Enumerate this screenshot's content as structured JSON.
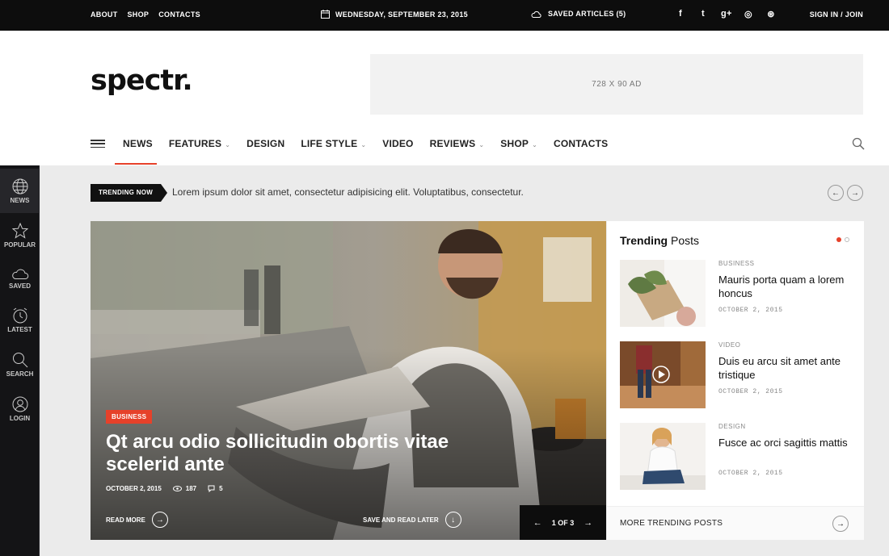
{
  "topbar": {
    "links": [
      "ABOUT",
      "SHOP",
      "CONTACTS"
    ],
    "date": "WEDNESDAY, SEPTEMBER 23, 2015",
    "saved": "SAVED ARTICLES (5)",
    "social_icons": [
      "facebook-icon",
      "twitter-icon",
      "google-plus-icon",
      "instagram-icon",
      "dribbble-icon"
    ],
    "social_glyphs": [
      "f",
      "t",
      "g+",
      "◎",
      "⊛"
    ],
    "sign": "SIGN IN / JOIN"
  },
  "header": {
    "logo": "spectr.",
    "ad": "728 X 90 AD"
  },
  "nav": {
    "items": [
      {
        "label": "NEWS",
        "dropdown": false
      },
      {
        "label": "FEATURES",
        "dropdown": true
      },
      {
        "label": "DESIGN",
        "dropdown": false
      },
      {
        "label": "LIFE STYLE",
        "dropdown": true
      },
      {
        "label": "VIDEO",
        "dropdown": false
      },
      {
        "label": "REVIEWS",
        "dropdown": true
      },
      {
        "label": "SHOP",
        "dropdown": true
      },
      {
        "label": "CONTACTS",
        "dropdown": false
      }
    ],
    "caret": "⌄",
    "active": "NEWS"
  },
  "sidebar": {
    "items": [
      {
        "label": "NEWS",
        "icon": "globe-icon"
      },
      {
        "label": "POPULAR",
        "icon": "star-icon"
      },
      {
        "label": "SAVED",
        "icon": "cloud-icon"
      },
      {
        "label": "LATEST",
        "icon": "clock-icon"
      },
      {
        "label": "SEARCH",
        "icon": "search-icon"
      },
      {
        "label": "LOGIN",
        "icon": "user-icon"
      }
    ]
  },
  "trending_bar": {
    "badge": "TRENDING NOW",
    "text": "Lorem ipsum dolor sit amet, consectetur adipisicing elit. Voluptatibus, consectetur.",
    "prev": "←",
    "next": "→"
  },
  "hero": {
    "category": "BUSINESS",
    "title": "Qt arcu odio sollicitudin obortis vitae scelerid ante",
    "date": "OCTOBER 2, 2015",
    "views": "187",
    "comments": "5",
    "read_more": "READ MORE",
    "read_more_arrow": "→",
    "save_later": "SAVE AND READ LATER",
    "save_arrow": "↓",
    "pager": "1 OF 3",
    "pager_prev": "←",
    "pager_next": "→"
  },
  "trending": {
    "title_bold": "Trending",
    "title_rest": " Posts",
    "accent": "#e6412a",
    "posts": [
      {
        "category": "BUSINESS",
        "title": "Mauris porta quam a lorem honcus",
        "date": "OCTOBER 2, 2015"
      },
      {
        "category": "VIDEO",
        "title": "Duis eu arcu sit amet ante tristique",
        "date": "OCTOBER 2, 2015"
      },
      {
        "category": "DESIGN",
        "title": "Fusce ac orci sagittis mattis",
        "date": "OCTOBER 2, 2015"
      }
    ],
    "more": "MORE TRENDING POSTS",
    "more_arrow": "→"
  }
}
